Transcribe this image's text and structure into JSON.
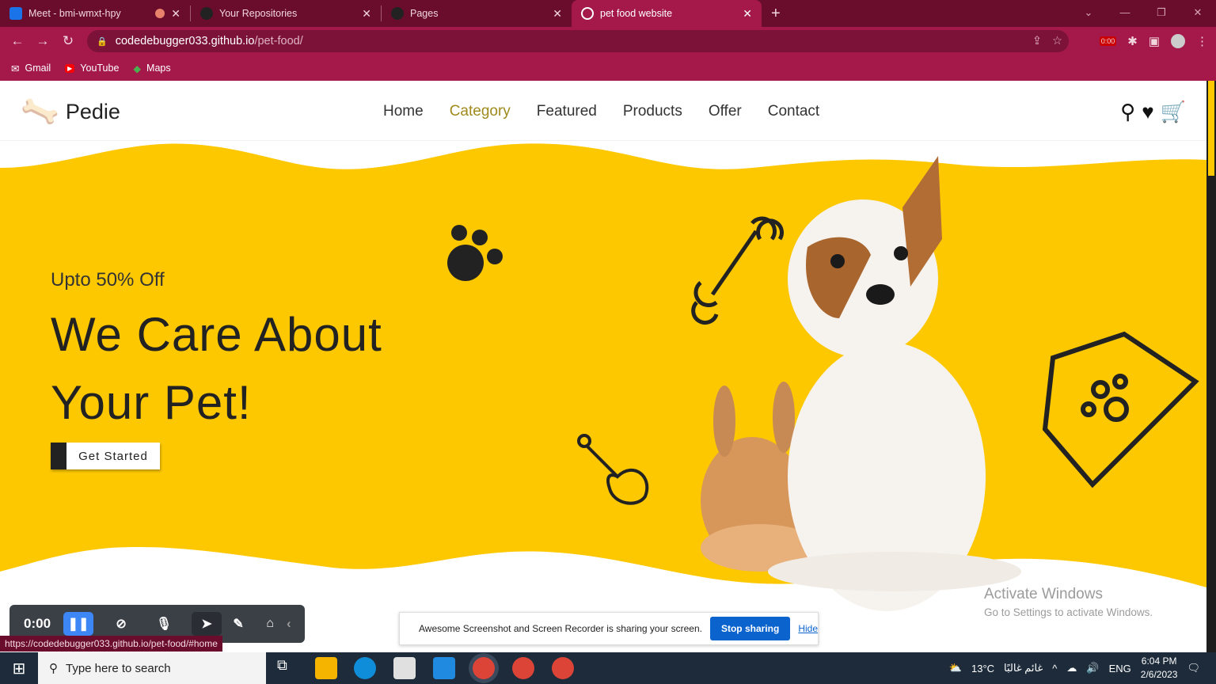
{
  "browser": {
    "tabs": [
      {
        "title": "Meet - bmi-wmxt-hpy",
        "active": false
      },
      {
        "title": "Your Repositories",
        "active": false
      },
      {
        "title": "Pages",
        "active": false
      },
      {
        "title": "pet food website",
        "active": true
      }
    ],
    "url_host": "codedebugger033.github.io",
    "url_path": "/pet-food/",
    "extension_badge": "0:00",
    "bookmarks": [
      "Gmail",
      "YouTube",
      "Maps"
    ],
    "status_url": "https://codedebugger033.github.io/pet-food/#home"
  },
  "site": {
    "logo": "Pedie",
    "nav": [
      "Home",
      "Category",
      "Featured",
      "Products",
      "Offer",
      "Contact"
    ],
    "hero": {
      "subtitle": "Upto 50% Off",
      "title_line1": "We Care About",
      "title_line2": "Your Pet!",
      "cta": "Get Started"
    },
    "colors": {
      "accent": "#fdc800",
      "dark": "#222222"
    }
  },
  "recorder": {
    "timer": "0:00"
  },
  "share_bar": {
    "message": "Awesome Screenshot and Screen Recorder is sharing your screen.",
    "stop": "Stop sharing",
    "hide": "Hide"
  },
  "watermark": {
    "title": "Activate Windows",
    "subtitle": "Go to Settings to activate Windows."
  },
  "taskbar": {
    "search_placeholder": "Type here to search",
    "weather": "13°C",
    "weather_text": "غائم غالبًا",
    "lang": "ENG",
    "time": "6:04 PM",
    "date": "2/6/2023"
  }
}
